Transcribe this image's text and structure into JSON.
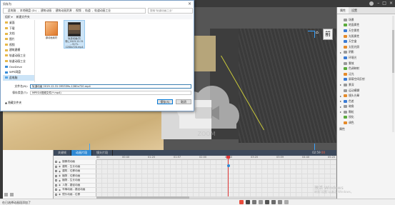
{
  "dialog": {
    "title": "另存为",
    "breadcrumb": [
      "此电脑",
      "本地磁盘 (D:)",
      "建筑动画",
      "建筑动画资源",
      "视频",
      "轨道",
      "轨道动画工业"
    ],
    "search_placeholder": "搜索\"轨道动画工业\"",
    "toolbar": [
      "组织 ▾",
      "新建文件夹"
    ],
    "sidebar": [
      "桌面",
      "下载",
      "文档",
      "图片",
      "视频",
      "建筑建模",
      "轨道动画工业",
      "轨道动画工业",
      "OneDrive",
      "WPS网盘",
      "此电脑"
    ],
    "files": [
      {
        "name": "源动画素材",
        "kind": "doc"
      },
      {
        "name": "轨道动画(阶梯)_2019-12-31 ...3171-1280x720.mp4",
        "kind": "vid"
      }
    ],
    "filename_label": "文件名(N):",
    "filename_value": "轨道动画 2019-12-31 095339s-1280x720.mp4",
    "filetype_label": "保存类型(T):",
    "filetype_value": "MPEG4视频文件(*.mp4)",
    "hide_folders": "▲ 隐藏文件夹",
    "save_label": "保存(S)",
    "cancel_label": "取消"
  },
  "viewport": {
    "view_cube_label": "前",
    "watermark_text": "ZOOM"
  },
  "props": {
    "tabs": [
      "属性",
      "设置"
    ],
    "rows": [
      {
        "label": "场景",
        "icon": "gray",
        "arrow": ""
      },
      {
        "label": "地面属性",
        "icon": "green",
        "arrow": ""
      },
      {
        "label": "天空属性",
        "icon": "blue",
        "arrow": ""
      },
      {
        "label": "光照属性",
        "icon": "orange",
        "arrow": ""
      },
      {
        "label": "天空盒",
        "icon": "blue",
        "arrow": ""
      },
      {
        "label": "太阳光照",
        "icon": "orange",
        "arrow": ""
      },
      {
        "label": "阴影",
        "icon": "gray",
        "arrow": "▸"
      },
      {
        "label": "环境光",
        "icon": "blue",
        "arrow": ""
      },
      {
        "label": "雾效",
        "icon": "gray",
        "arrow": ""
      },
      {
        "label": "色调映射",
        "icon": "green",
        "arrow": ""
      },
      {
        "label": "泛光",
        "icon": "orange",
        "arrow": ""
      },
      {
        "label": "屏幕空间反射",
        "icon": "blue",
        "arrow": ""
      },
      {
        "label": "景深",
        "icon": "gray",
        "arrow": "▸"
      },
      {
        "label": "运动模糊",
        "icon": "gray",
        "arrow": ""
      },
      {
        "label": "镜头光晕",
        "icon": "orange",
        "arrow": "▸"
      },
      {
        "label": "色差",
        "icon": "blue",
        "arrow": "▸"
      },
      {
        "label": "暗角",
        "icon": "gray",
        "arrow": "▸"
      },
      {
        "label": "颗粒",
        "icon": "gray",
        "arrow": "▸"
      },
      {
        "label": "锐化",
        "icon": "green",
        "arrow": ""
      },
      {
        "label": "调色",
        "icon": "orange",
        "arrow": ""
      }
    ],
    "section": "属性"
  },
  "timeline": {
    "tabs": [
      "关键帧",
      "动画片段",
      "镜头片段"
    ],
    "active_tab": 1,
    "time_display": "02:59",
    "time_current": "00",
    "ruler": [
      "00",
      "00:40",
      "01:20",
      "01:57",
      "02:00",
      "02:40",
      "03:20",
      "03:59",
      "04:40",
      "05:20"
    ],
    "tracks": [
      "摄像机动画",
      "建筑 - 生长动画",
      "建筑 - 位移动画",
      "植物 - 位移动画",
      "植物 - 生长动画",
      "人物 - 路径动画",
      "车辆动画 - 路径动画",
      "镜头动画 - 位移"
    ]
  },
  "status": {
    "text": "在已选择动画段添加了",
    "activate_title": "激活 Windows",
    "activate_sub": "转到\"设置\"以激活 Windows。"
  },
  "colors": {
    "accent": "#2e89d4",
    "playhead": "#e23a3a",
    "frame_corner": "#3aa3ff"
  }
}
